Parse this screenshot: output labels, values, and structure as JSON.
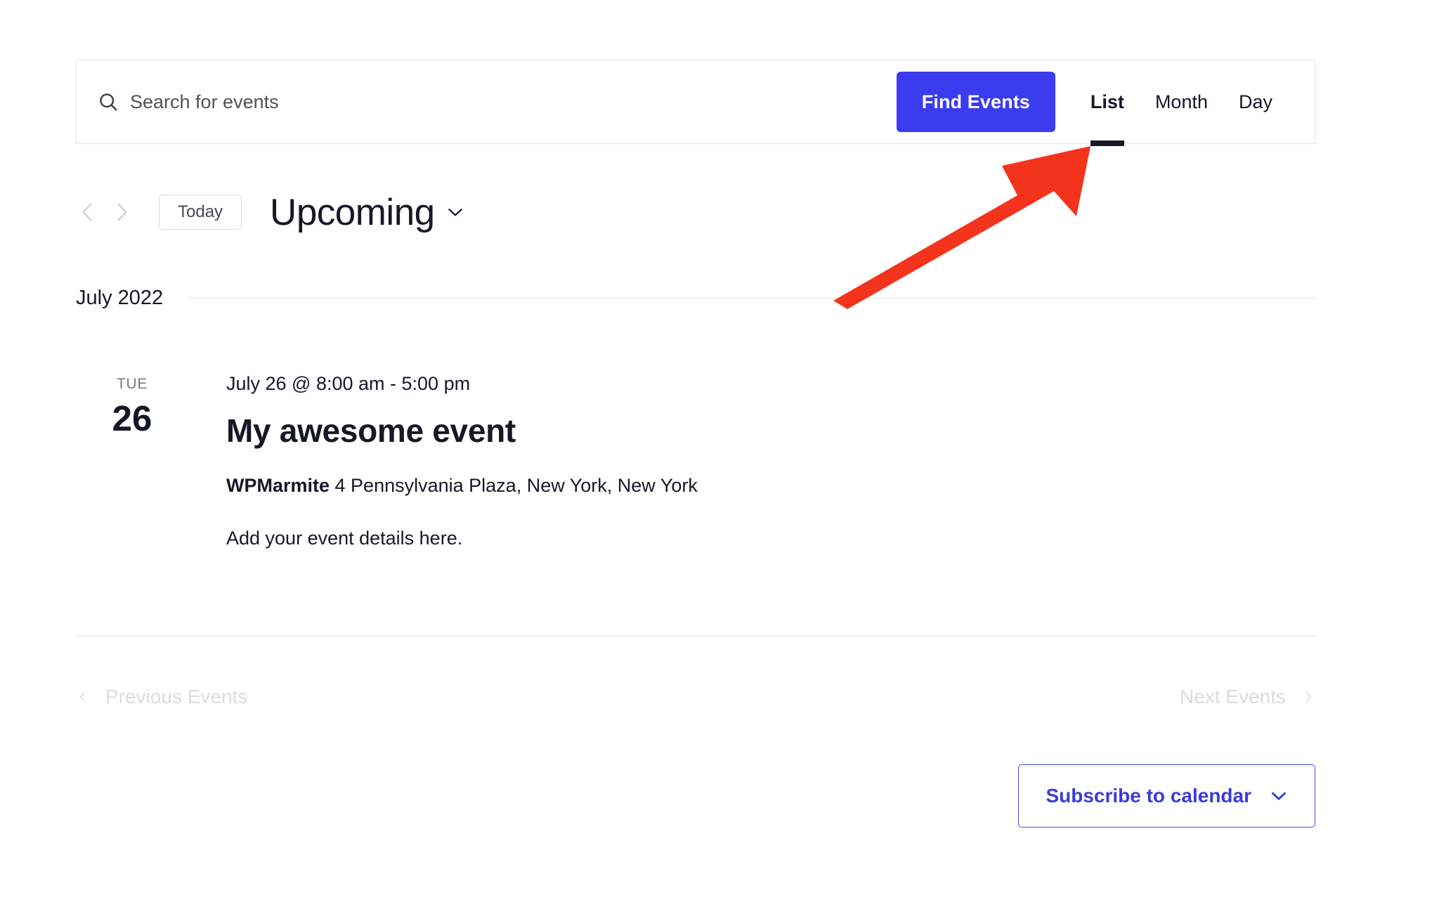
{
  "header": {
    "search": {
      "placeholder": "Search for events",
      "value": "",
      "icon": "search-icon"
    },
    "find_events_label": "Find Events",
    "accent_color": "#3b3bf0",
    "tabs": [
      {
        "label": "List",
        "active": true
      },
      {
        "label": "Month",
        "active": false
      },
      {
        "label": "Day",
        "active": false
      }
    ]
  },
  "nav": {
    "prev_icon": "chevron-left-icon",
    "next_icon": "chevron-right-icon",
    "today_label": "Today",
    "view_title": "Upcoming",
    "view_title_chevron": "chevron-down-icon"
  },
  "month_separator": {
    "label": "July 2022"
  },
  "events": [
    {
      "weekday": "TUE",
      "day": "26",
      "time": "July 26 @ 8:00 am - 5:00 pm",
      "title": "My awesome event",
      "venue_name": "WPMarmite",
      "venue_address": "4 Pennsylvania Plaza, New York, New York",
      "description": "Add your event details here."
    }
  ],
  "pagination": {
    "previous_label": "Previous Events",
    "next_label": "Next Events",
    "previous_icon": "chevron-left-icon",
    "next_icon": "chevron-right-icon",
    "disabled_color": "#dcdcdc"
  },
  "subscribe": {
    "label": "Subscribe to calendar",
    "chevron": "chevron-down-icon",
    "color": "#3b3bd8"
  },
  "annotation": {
    "type": "arrow",
    "color": "#f4331c",
    "points_to": "List"
  }
}
